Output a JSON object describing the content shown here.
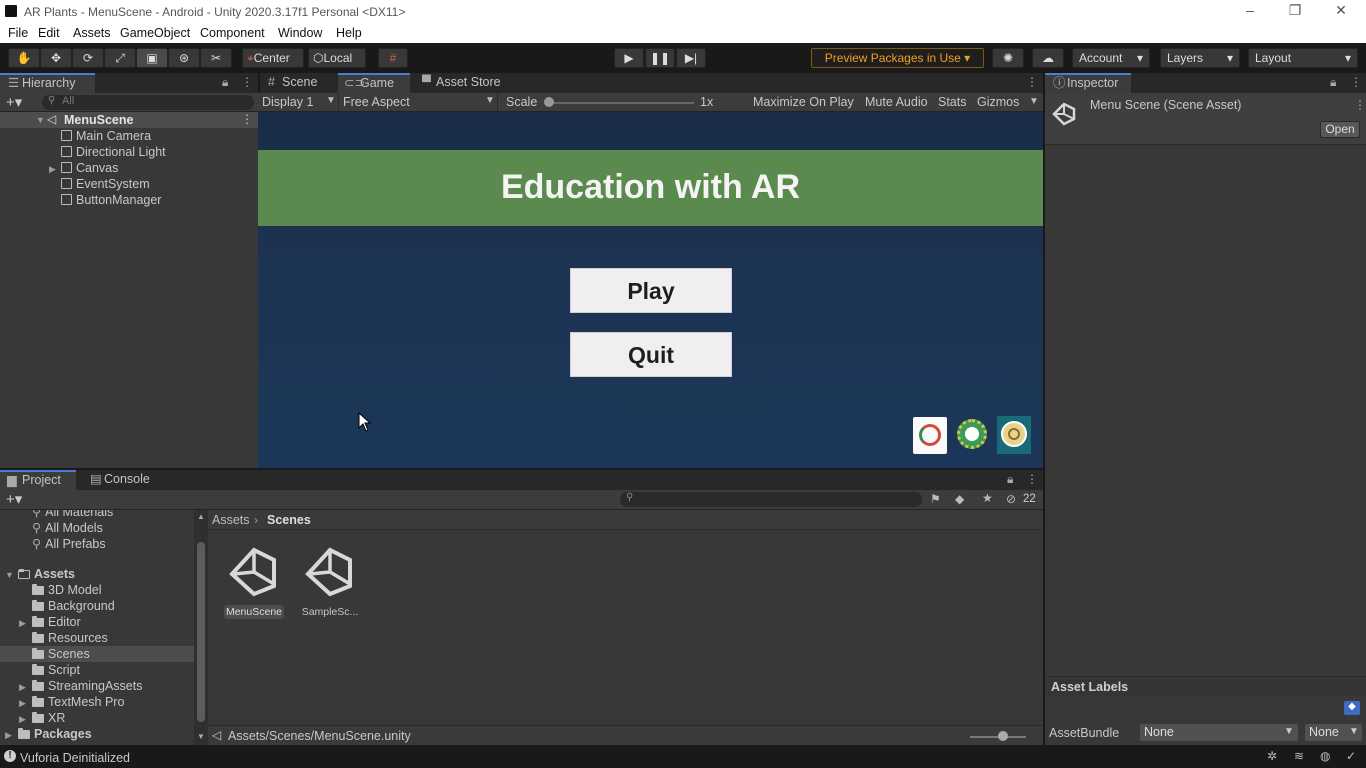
{
  "window": {
    "title": "AR Plants - MenuScene - Android - Unity 2020.3.17f1 Personal <DX11>",
    "controls": [
      "–",
      "❐",
      "✕"
    ]
  },
  "menu": [
    "File",
    "Edit",
    "Assets",
    "GameObject",
    "Component",
    "Window",
    "Help"
  ],
  "toolbar": {
    "pivot_label": "Center",
    "space_label": "Local",
    "preview_packages_label": "Preview Packages in Use",
    "account_label": "Account",
    "layers_label": "Layers",
    "layout_label": "Layout",
    "accent_color": "#f0a020"
  },
  "hierarchy": {
    "tab_label": "Hierarchy",
    "search_placeholder": "All",
    "scene_name": "MenuScene",
    "items": [
      "Main Camera",
      "Directional Light",
      "Canvas",
      "EventSystem",
      "ButtonManager"
    ]
  },
  "game_view": {
    "tabs": [
      "Scene",
      "Game",
      "Asset Store"
    ],
    "active_tab": "Game",
    "display_label": "Display 1",
    "aspect_label": "Free Aspect",
    "scale_label": "Scale",
    "scale_value": "1x",
    "toggles": [
      "Maximize On Play",
      "Mute Audio",
      "Stats",
      "Gizmos"
    ],
    "game_title": "Education with AR",
    "play_button": "Play",
    "quit_button": "Quit",
    "header_color": "#5c8a4e",
    "background_color": "#1c3350"
  },
  "inspector": {
    "tab_label": "Inspector",
    "asset_title": "Menu Scene (Scene Asset)",
    "open_button": "Open",
    "asset_labels_title": "Asset Labels",
    "assetbundle_label": "AssetBundle",
    "assetbundle_value": "None",
    "variant_value": "None"
  },
  "project": {
    "tabs": [
      "Project",
      "Console"
    ],
    "hidden_count": "22",
    "favorites": [
      "All Materials",
      "All Models",
      "All Prefabs"
    ],
    "assets_root": "Assets",
    "folders": [
      "3D Model",
      "Background",
      "Editor",
      "Resources",
      "Scenes",
      "Script",
      "StreamingAssets",
      "TextMesh Pro",
      "XR"
    ],
    "packages_label": "Packages",
    "breadcrumb": [
      "Assets",
      "Scenes"
    ],
    "files": [
      "MenuScene",
      "SampleSc..."
    ],
    "selected_path": "Assets/Scenes/MenuScene.unity"
  },
  "status": {
    "message": "Vuforia Deinitialized"
  }
}
